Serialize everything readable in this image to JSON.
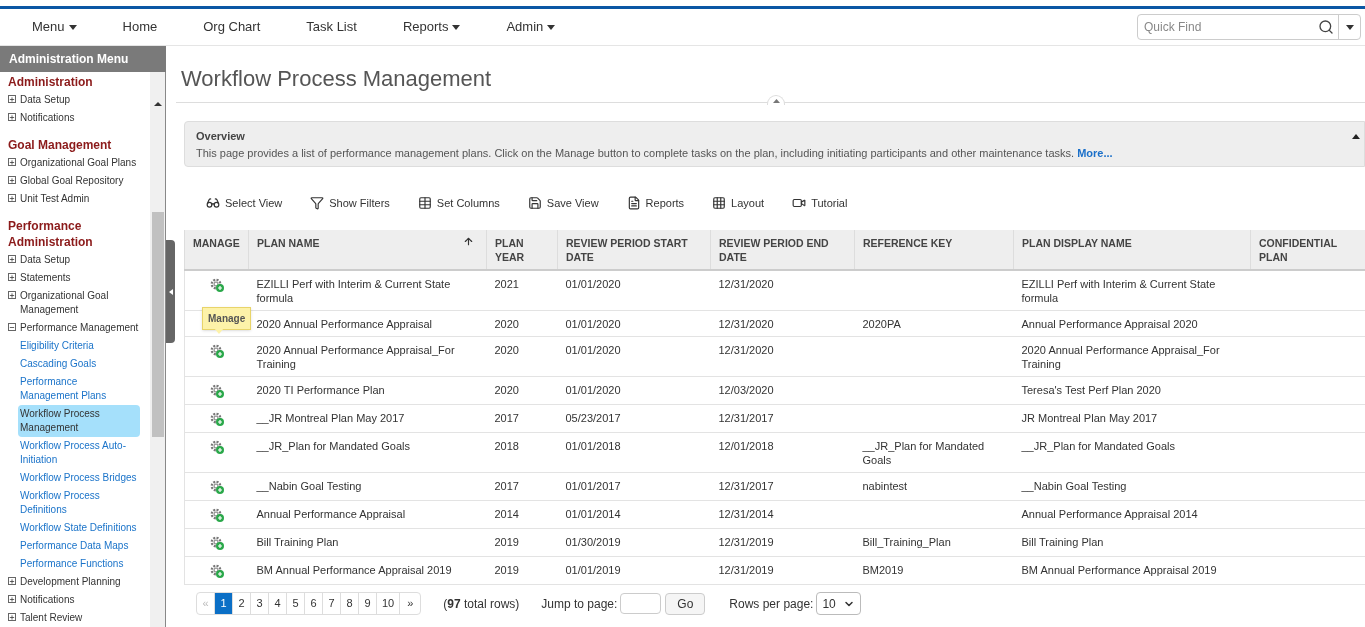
{
  "nav": {
    "items": [
      {
        "label": "Menu",
        "dropdown": true
      },
      {
        "label": "Home",
        "dropdown": false
      },
      {
        "label": "Org Chart",
        "dropdown": false
      },
      {
        "label": "Task List",
        "dropdown": false
      },
      {
        "label": "Reports",
        "dropdown": true
      },
      {
        "label": "Admin",
        "dropdown": true
      }
    ],
    "search": {
      "placeholder": "Quick Find"
    }
  },
  "sidebar": {
    "title": "Administration Menu",
    "sections": [
      {
        "title": "Administration",
        "items": [
          {
            "label": "Data Setup",
            "expanded": false
          },
          {
            "label": "Notifications",
            "expanded": false
          }
        ]
      },
      {
        "title": "Goal Management",
        "items": [
          {
            "label": "Organizational Goal Plans",
            "expanded": false
          },
          {
            "label": "Global Goal Repository",
            "expanded": false
          },
          {
            "label": "Unit Test Admin",
            "expanded": false
          }
        ]
      },
      {
        "title": "Performance Administration",
        "items": [
          {
            "label": "Data Setup",
            "expanded": false
          },
          {
            "label": "Statements",
            "expanded": false
          },
          {
            "label": "Organizational Goal Management",
            "expanded": false
          },
          {
            "label": "Performance Management",
            "expanded": true,
            "children": [
              {
                "label": "Eligibility Criteria",
                "selected": false
              },
              {
                "label": "Cascading Goals",
                "selected": false
              },
              {
                "label": "Performance Management Plans",
                "selected": false
              },
              {
                "label": "Workflow Process Management",
                "selected": true
              },
              {
                "label": "Workflow Process Auto-Initiation",
                "selected": false
              },
              {
                "label": "Workflow Process Bridges",
                "selected": false
              },
              {
                "label": "Workflow Process Definitions",
                "selected": false
              },
              {
                "label": "Workflow State Definitions",
                "selected": false
              },
              {
                "label": "Performance Data Maps",
                "selected": false
              },
              {
                "label": "Performance Functions",
                "selected": false
              }
            ]
          },
          {
            "label": "Development Planning",
            "expanded": false
          },
          {
            "label": "Notifications",
            "expanded": false
          },
          {
            "label": "Talent Review",
            "expanded": false
          }
        ]
      }
    ]
  },
  "page_title": "Workflow Process Management",
  "overview": {
    "title": "Overview",
    "text": "This page provides a list of performance management plans. Click on the Manage button to complete tasks on the plan, including initiating participants and other maintenance tasks.",
    "more_link": "More..."
  },
  "toolbar": [
    {
      "kind": "view",
      "label": "Select View"
    },
    {
      "kind": "filter",
      "label": "Show Filters"
    },
    {
      "kind": "columns",
      "label": "Set Columns"
    },
    {
      "kind": "save",
      "label": "Save View"
    },
    {
      "kind": "reports",
      "label": "Reports"
    },
    {
      "kind": "layout",
      "label": "Layout"
    },
    {
      "kind": "tutorial",
      "label": "Tutorial"
    }
  ],
  "table": {
    "columns": [
      {
        "label": "MANAGE",
        "sorted": false
      },
      {
        "label": "PLAN NAME",
        "sorted": true
      },
      {
        "label": "PLAN YEAR",
        "sorted": false
      },
      {
        "label": "REVIEW PERIOD START DATE",
        "sorted": false
      },
      {
        "label": "REVIEW PERIOD END DATE",
        "sorted": false
      },
      {
        "label": "REFERENCE KEY",
        "sorted": false
      },
      {
        "label": "PLAN DISPLAY NAME",
        "sorted": false
      },
      {
        "label": "CONFIDENTIAL PLAN",
        "sorted": false
      }
    ],
    "rows": [
      {
        "cells": [
          "",
          "EZILLI Perf with Interim & Current State formula",
          "2021",
          "01/01/2020",
          "12/31/2020",
          "",
          "EZILLI Perf with Interim & Current State formula",
          ""
        ]
      },
      {
        "tooltip": "Manage",
        "cells": [
          "",
          "2020 Annual Performance Appraisal",
          "2020",
          "01/01/2020",
          "12/31/2020",
          "2020PA",
          "Annual Performance Appraisal 2020",
          ""
        ]
      },
      {
        "cells": [
          "",
          "2020 Annual Performance Appraisal_For Training",
          "2020",
          "01/01/2020",
          "12/31/2020",
          "",
          "2020 Annual Performance Appraisal_For Training",
          ""
        ]
      },
      {
        "cells": [
          "",
          "2020 TI Performance Plan",
          "2020",
          "01/01/2020",
          "12/03/2020",
          "",
          "Teresa's Test Perf Plan 2020",
          ""
        ]
      },
      {
        "cells": [
          "",
          "__JR Montreal Plan May 2017",
          "2017",
          "05/23/2017",
          "12/31/2017",
          "",
          "JR Montreal Plan May 2017",
          ""
        ]
      },
      {
        "cells": [
          "",
          "__JR_Plan for Mandated Goals",
          "2018",
          "01/01/2018",
          "12/01/2018",
          "__JR_Plan for Mandated Goals",
          "__JR_Plan for Mandated Goals",
          ""
        ]
      },
      {
        "cells": [
          "",
          "__Nabin Goal Testing",
          "2017",
          "01/01/2017",
          "12/31/2017",
          "nabintest",
          "__Nabin Goal Testing",
          ""
        ]
      },
      {
        "cells": [
          "",
          "Annual Performance Appraisal",
          "2014",
          "01/01/2014",
          "12/31/2014",
          "",
          "Annual Performance Appraisal 2014",
          ""
        ]
      },
      {
        "cells": [
          "",
          "Bill Training Plan",
          "2019",
          "01/30/2019",
          "12/31/2019",
          "Bill_Training_Plan",
          "Bill Training Plan",
          ""
        ]
      },
      {
        "cells": [
          "",
          "BM Annual Performance Appraisal 2019",
          "2019",
          "01/01/2019",
          "12/31/2019",
          "BM2019",
          "BM Annual Performance Appraisal 2019",
          ""
        ]
      }
    ]
  },
  "pagination": {
    "prev": "«",
    "next": "»",
    "pages": [
      {
        "label": "1",
        "selected": true
      },
      {
        "label": "2",
        "selected": false
      },
      {
        "label": "3",
        "selected": false
      },
      {
        "label": "4",
        "selected": false
      },
      {
        "label": "5",
        "selected": false
      },
      {
        "label": "6",
        "selected": false
      },
      {
        "label": "7",
        "selected": false
      },
      {
        "label": "8",
        "selected": false
      },
      {
        "label": "9",
        "selected": false
      },
      {
        "label": "10",
        "selected": false
      }
    ],
    "total": "(**97** total rows)",
    "jump_label": "Jump to page:",
    "go": "Go",
    "rows_label": "Rows per page:",
    "rows_value": "10"
  }
}
